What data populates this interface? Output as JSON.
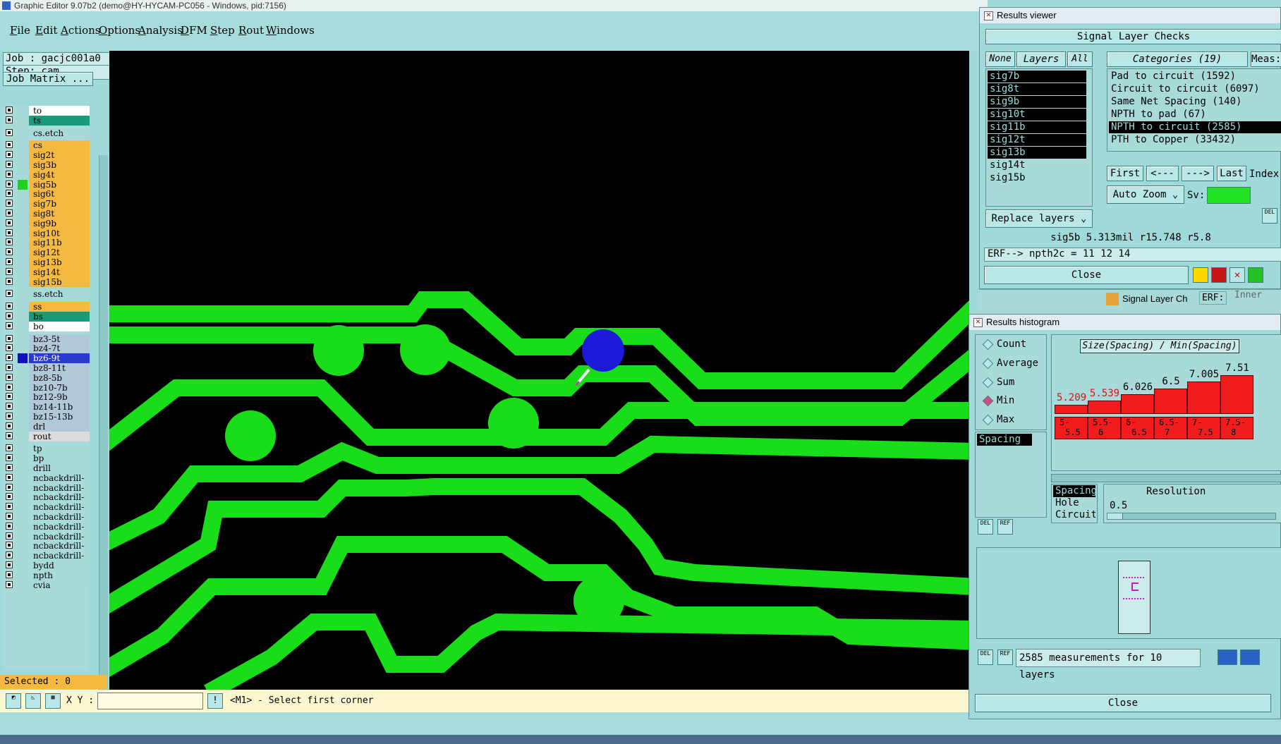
{
  "window": {
    "title": "Graphic Editor 9.07b2 (demo@HY-HYCAM-PC056 - Windows, pid:7156)"
  },
  "menu": [
    "File",
    "Edit",
    "Actions",
    "Options",
    "Analysis",
    "DFM",
    "Step",
    "Rout",
    "Windows"
  ],
  "job": {
    "job_label": "Job : gacjc001a0",
    "step_label": "Step: cam",
    "matrix_button": "Job Matrix ..."
  },
  "layers": [
    {
      "name": "to",
      "color": "#ffffff",
      "swatch": ""
    },
    {
      "name": "ts",
      "color": "#1a9a7a",
      "swatch": ""
    },
    {
      "name": "cs.etch",
      "color": "#a8dada",
      "swatch": ""
    },
    {
      "name": "cs",
      "color": "#f5b942",
      "swatch": ""
    },
    {
      "name": "sig2t",
      "color": "#f5b942",
      "swatch": ""
    },
    {
      "name": "sig3b",
      "color": "#f5b942",
      "swatch": ""
    },
    {
      "name": "sig4t",
      "color": "#f5b942",
      "swatch": ""
    },
    {
      "name": "sig5b",
      "color": "#f5b942",
      "swatch": "#22d022"
    },
    {
      "name": "sig6t",
      "color": "#f5b942",
      "swatch": ""
    },
    {
      "name": "sig7b",
      "color": "#f5b942",
      "swatch": ""
    },
    {
      "name": "sig8t",
      "color": "#f5b942",
      "swatch": ""
    },
    {
      "name": "sig9b",
      "color": "#f5b942",
      "swatch": ""
    },
    {
      "name": "sig10t",
      "color": "#f5b942",
      "swatch": ""
    },
    {
      "name": "sig11b",
      "color": "#f5b942",
      "swatch": ""
    },
    {
      "name": "sig12t",
      "color": "#f5b942",
      "swatch": ""
    },
    {
      "name": "sig13b",
      "color": "#f5b942",
      "swatch": ""
    },
    {
      "name": "sig14t",
      "color": "#f5b942",
      "swatch": ""
    },
    {
      "name": "sig15b",
      "color": "#f5b942",
      "swatch": ""
    },
    {
      "name": "ss.etch",
      "color": "#a8dada",
      "swatch": ""
    },
    {
      "name": "ss",
      "color": "#f5b942",
      "swatch": ""
    },
    {
      "name": "bs",
      "color": "#1a9a7a",
      "swatch": ""
    },
    {
      "name": "bo",
      "color": "#ffffff",
      "swatch": ""
    },
    {
      "name": "bz3-5t",
      "color": "#b0c8d8",
      "swatch": ""
    },
    {
      "name": "bz4-7t",
      "color": "#b0c8d8",
      "swatch": ""
    },
    {
      "name": "bz6-9t",
      "color": "#2a3ad0",
      "swatch": "#1010c0"
    },
    {
      "name": "bz8-11t",
      "color": "#b0c8d8",
      "swatch": ""
    },
    {
      "name": "bz8-5b",
      "color": "#b0c8d8",
      "swatch": ""
    },
    {
      "name": "bz10-7b",
      "color": "#b0c8d8",
      "swatch": ""
    },
    {
      "name": "bz12-9b",
      "color": "#b0c8d8",
      "swatch": ""
    },
    {
      "name": "bz14-11b",
      "color": "#b0c8d8",
      "swatch": ""
    },
    {
      "name": "bz15-13b",
      "color": "#b0c8d8",
      "swatch": ""
    },
    {
      "name": "drl",
      "color": "#b0c8d8",
      "swatch": ""
    },
    {
      "name": "rout",
      "color": "#dcdcdc",
      "swatch": ""
    },
    {
      "name": "tp",
      "color": "#a8dada",
      "swatch": ""
    },
    {
      "name": "bp",
      "color": "#a8dada",
      "swatch": ""
    },
    {
      "name": "drill",
      "color": "#a8dada",
      "swatch": ""
    },
    {
      "name": "ncbackdrill-",
      "color": "#a8dada",
      "swatch": ""
    },
    {
      "name": "ncbackdrill-",
      "color": "#a8dada",
      "swatch": ""
    },
    {
      "name": "ncbackdrill-",
      "color": "#a8dada",
      "swatch": ""
    },
    {
      "name": "ncbackdrill-",
      "color": "#a8dada",
      "swatch": ""
    },
    {
      "name": "ncbackdrill-",
      "color": "#a8dada",
      "swatch": ""
    },
    {
      "name": "ncbackdrill-",
      "color": "#a8dada",
      "swatch": ""
    },
    {
      "name": "ncbackdrill-",
      "color": "#a8dada",
      "swatch": ""
    },
    {
      "name": "ncbackdrill-",
      "color": "#a8dada",
      "swatch": ""
    },
    {
      "name": "ncbackdrill-",
      "color": "#a8dada",
      "swatch": ""
    },
    {
      "name": "bydd",
      "color": "#a8dada",
      "swatch": ""
    },
    {
      "name": "npth",
      "color": "#a8dada",
      "swatch": ""
    },
    {
      "name": "cvia",
      "color": "#a8dada",
      "swatch": ""
    }
  ],
  "selected": "Selected : 0",
  "cmd": {
    "xy_label": "X Y :",
    "xy_value": "",
    "prompt": "<M1> - Select first corner"
  },
  "viewer": {
    "title": "Results viewer",
    "header": "Signal Layer Checks",
    "none": "None",
    "layers_btn": "Layers",
    "all": "All",
    "layer_items": [
      "sig7b",
      "sig8t",
      "sig9b",
      "sig10t",
      "sig11b",
      "sig12t",
      "sig13b",
      "sig14t",
      "sig15b"
    ],
    "categories_header": "Categories (19)",
    "meas_header": "Meas:",
    "categories": [
      "Pad to circuit (1592)",
      "Circuit to circuit (6097)",
      "Same Net Spacing (140)",
      "NPTH to pad (67)",
      "NPTH to circuit (2585)",
      "PTH to Copper (33432)"
    ],
    "first": "First",
    "prev": "<---",
    "next": "--->",
    "last": "Last",
    "index": "Index",
    "auto_zoom": "Auto Zoom",
    "sv": "Sv:",
    "replace_layers": "Replace layers",
    "measure_line": "sig5b 5.313mil  r15.748  r5.8",
    "erf_line": "ERF--> npth2c = 11 12 14",
    "close": "Close",
    "behind_title": "Signal Layer Ch",
    "behind_erf": "ERF:",
    "behind_field": "Inner"
  },
  "histogram": {
    "title": "Results histogram",
    "stats": [
      "Count",
      "Average",
      "Sum",
      "Min",
      "Max"
    ],
    "selected_stat": "Min",
    "chart_title": "Size(Spacing) / Min(Spacing)",
    "spacing_list": [
      "Spacing"
    ],
    "resolution_label": "Resolution",
    "resolution_value": "0.5",
    "size_options": [
      "Spacing",
      "Hole",
      "Circuit"
    ],
    "summary": "2585 measurements for 10 layers",
    "close": "Close"
  },
  "chart_data": {
    "type": "bar",
    "title": "Size(Spacing) / Min(Spacing)",
    "categories": [
      "5-5.5",
      "5.5-6",
      "6-6.5",
      "6.5-7",
      "7-7.5",
      "7.5-8"
    ],
    "values": [
      5.209,
      5.539,
      6.026,
      6.5,
      7.005,
      7.51
    ],
    "labels": [
      "5.209",
      "5.539",
      "6.026",
      "6.5",
      "7.005",
      "7.51"
    ],
    "range_labels": [
      [
        "5-",
        "5.5"
      ],
      [
        "5.5-",
        "6"
      ],
      [
        "6-",
        "6.5"
      ],
      [
        "6.5-",
        "7"
      ],
      [
        "7-",
        "7.5"
      ],
      [
        "7.5-",
        "8"
      ]
    ],
    "highlight_color": "#f21c1c"
  }
}
